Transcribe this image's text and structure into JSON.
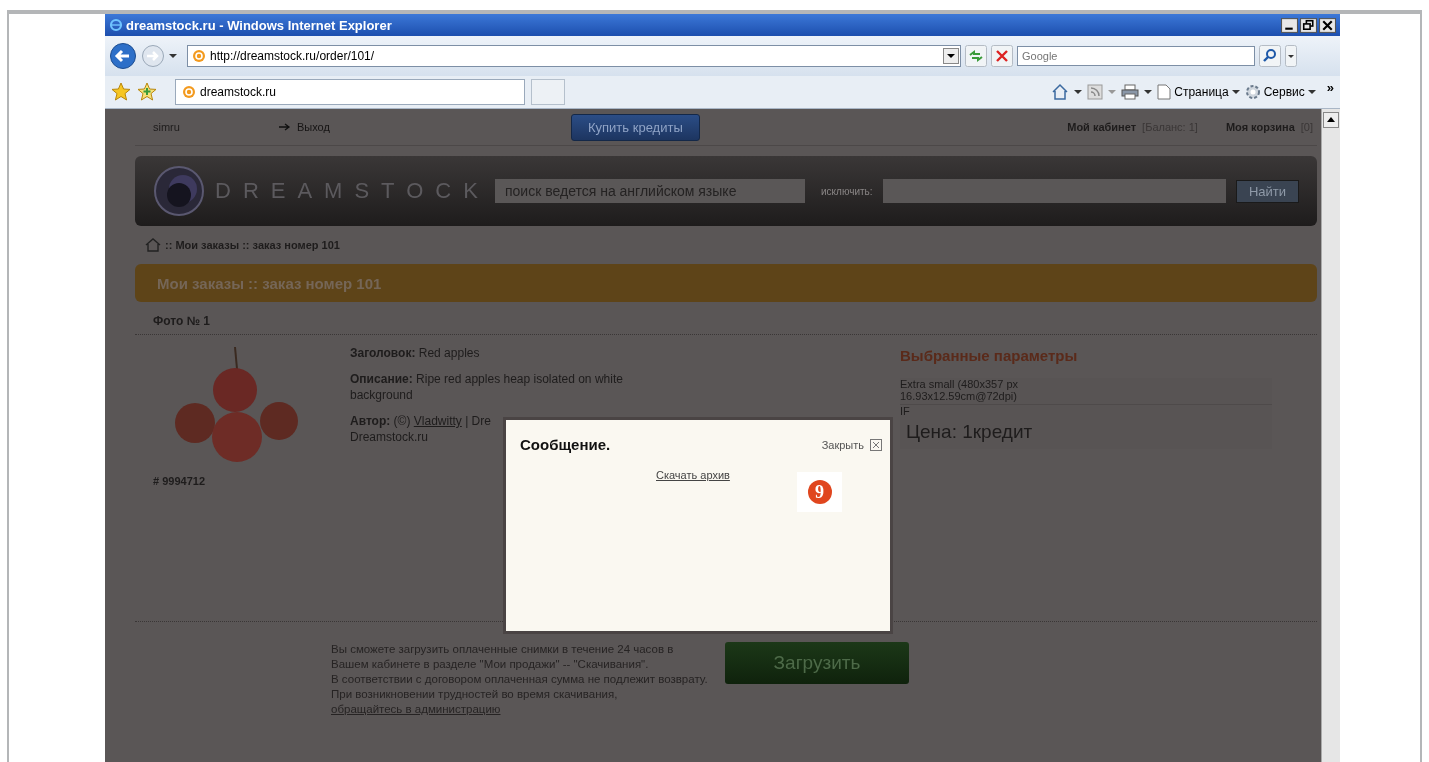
{
  "window": {
    "title": "dreamstock.ru - Windows Internet Explorer"
  },
  "address_bar": {
    "url": "http://dreamstock.ru/order/101/"
  },
  "search": {
    "placeholder": "Google"
  },
  "tabs": [
    {
      "label": "dreamstock.ru",
      "selected": true
    }
  ],
  "command_bar": {
    "items": [
      {
        "label": "Страница"
      },
      {
        "label": "Сервис"
      }
    ],
    "more": "»"
  },
  "page": {
    "top_bar": {
      "user": "simru",
      "logout": "Выход",
      "buy_button": "Купить кредиты",
      "cabinet": "Мой кабинет",
      "balance": "[Баланс: 1]",
      "cart": "Моя корзина",
      "cart_count": "[0]"
    },
    "header": {
      "logo": "DREAMSTOCK",
      "search_value": "поиск ведется на английском языке",
      "exclude_label": "исключить:",
      "find_button": "Найти"
    },
    "breadcrumb": ":: Мои заказы :: заказ номер 101",
    "banner": "Мои заказы :: заказ номер 101",
    "photo_heading": "Фото № 1",
    "photo_id": "# 9994712",
    "details": [
      {
        "label": "Заголовок:",
        "value": "Red apples"
      },
      {
        "label": "Описание:",
        "value": "Ripe red apples heap isolated on white background"
      }
    ],
    "author": {
      "label": "Автор:",
      "prefix": "(©)",
      "link": "Vladwitty",
      "rest": "| Dre",
      "line2": "Dreamstock.ru"
    },
    "params": {
      "heading": "Выбранные параметры",
      "size": "Extra small (480x357 px",
      "dimensions": "16.93x12.59cm@72dpi)",
      "format": "IF",
      "price": "Цена: 1кредит"
    },
    "notes": [
      "Вы сможете загрузить оплаченные снимки в течение 24 часов в Вашем кабинете в разделе \"Мои продажи\" -- \"Скачивания\".",
      "В соответствии с договором оплаченная сумма не подлежит возврату."
    ],
    "help": {
      "text": "При возникновении трудностей во время скачивания,",
      "link": "обращайтесь в администрацию"
    },
    "download_button": "Загрузить"
  },
  "dialog": {
    "title": "Сообщение.",
    "close_label": "Закрыть",
    "link": "Скачать архив"
  },
  "callout": {
    "label": "9"
  }
}
